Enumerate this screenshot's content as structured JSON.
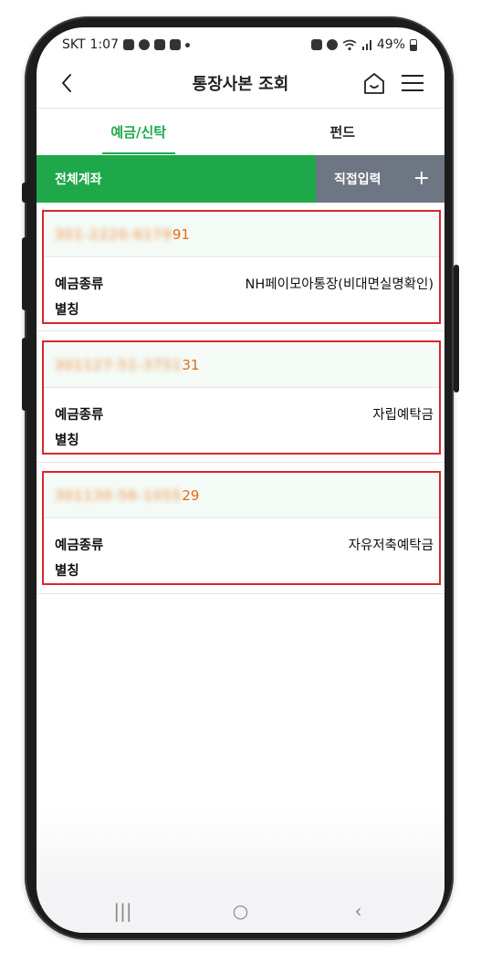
{
  "status": {
    "carrier": "SKT",
    "time": "1:07",
    "battery": "49%",
    "left_icons": [
      "chat-icon",
      "kakao-icon",
      "gallery-icon",
      "app-icon"
    ],
    "right_icons": [
      "alarm-icon",
      "clock-icon",
      "wifi-icon",
      "signal-icon",
      "battery-icon"
    ]
  },
  "header": {
    "title": "통장사본 조회"
  },
  "tabs": [
    {
      "label": "예금/신탁",
      "active": true
    },
    {
      "label": "펀드",
      "active": false
    }
  ],
  "account_bar": {
    "all_label": "전체계좌",
    "direct_label": "직접입력",
    "plus": "+"
  },
  "accounts": [
    {
      "number_masked": "301-2220-6179",
      "number_tail": "91",
      "type_label": "예금종류",
      "type_value": "NH페이모아통장(비대면실명확인)",
      "alias_label": "별칭"
    },
    {
      "number_masked": "301127-51-3751",
      "number_tail": "31",
      "type_label": "예금종류",
      "type_value": "자립예탁금",
      "alias_label": "별칭"
    },
    {
      "number_masked": "301130-56-1055",
      "number_tail": "29",
      "type_label": "예금종류",
      "type_value": "자유저축예탁금",
      "alias_label": "별칭"
    }
  ],
  "nav": {
    "recent": "|||",
    "home": "○",
    "back": "‹"
  },
  "colors": {
    "accent_green": "#1fa84a",
    "gray_button": "#6e7583",
    "highlight_red": "#d8262e",
    "account_orange": "#e66b13"
  }
}
